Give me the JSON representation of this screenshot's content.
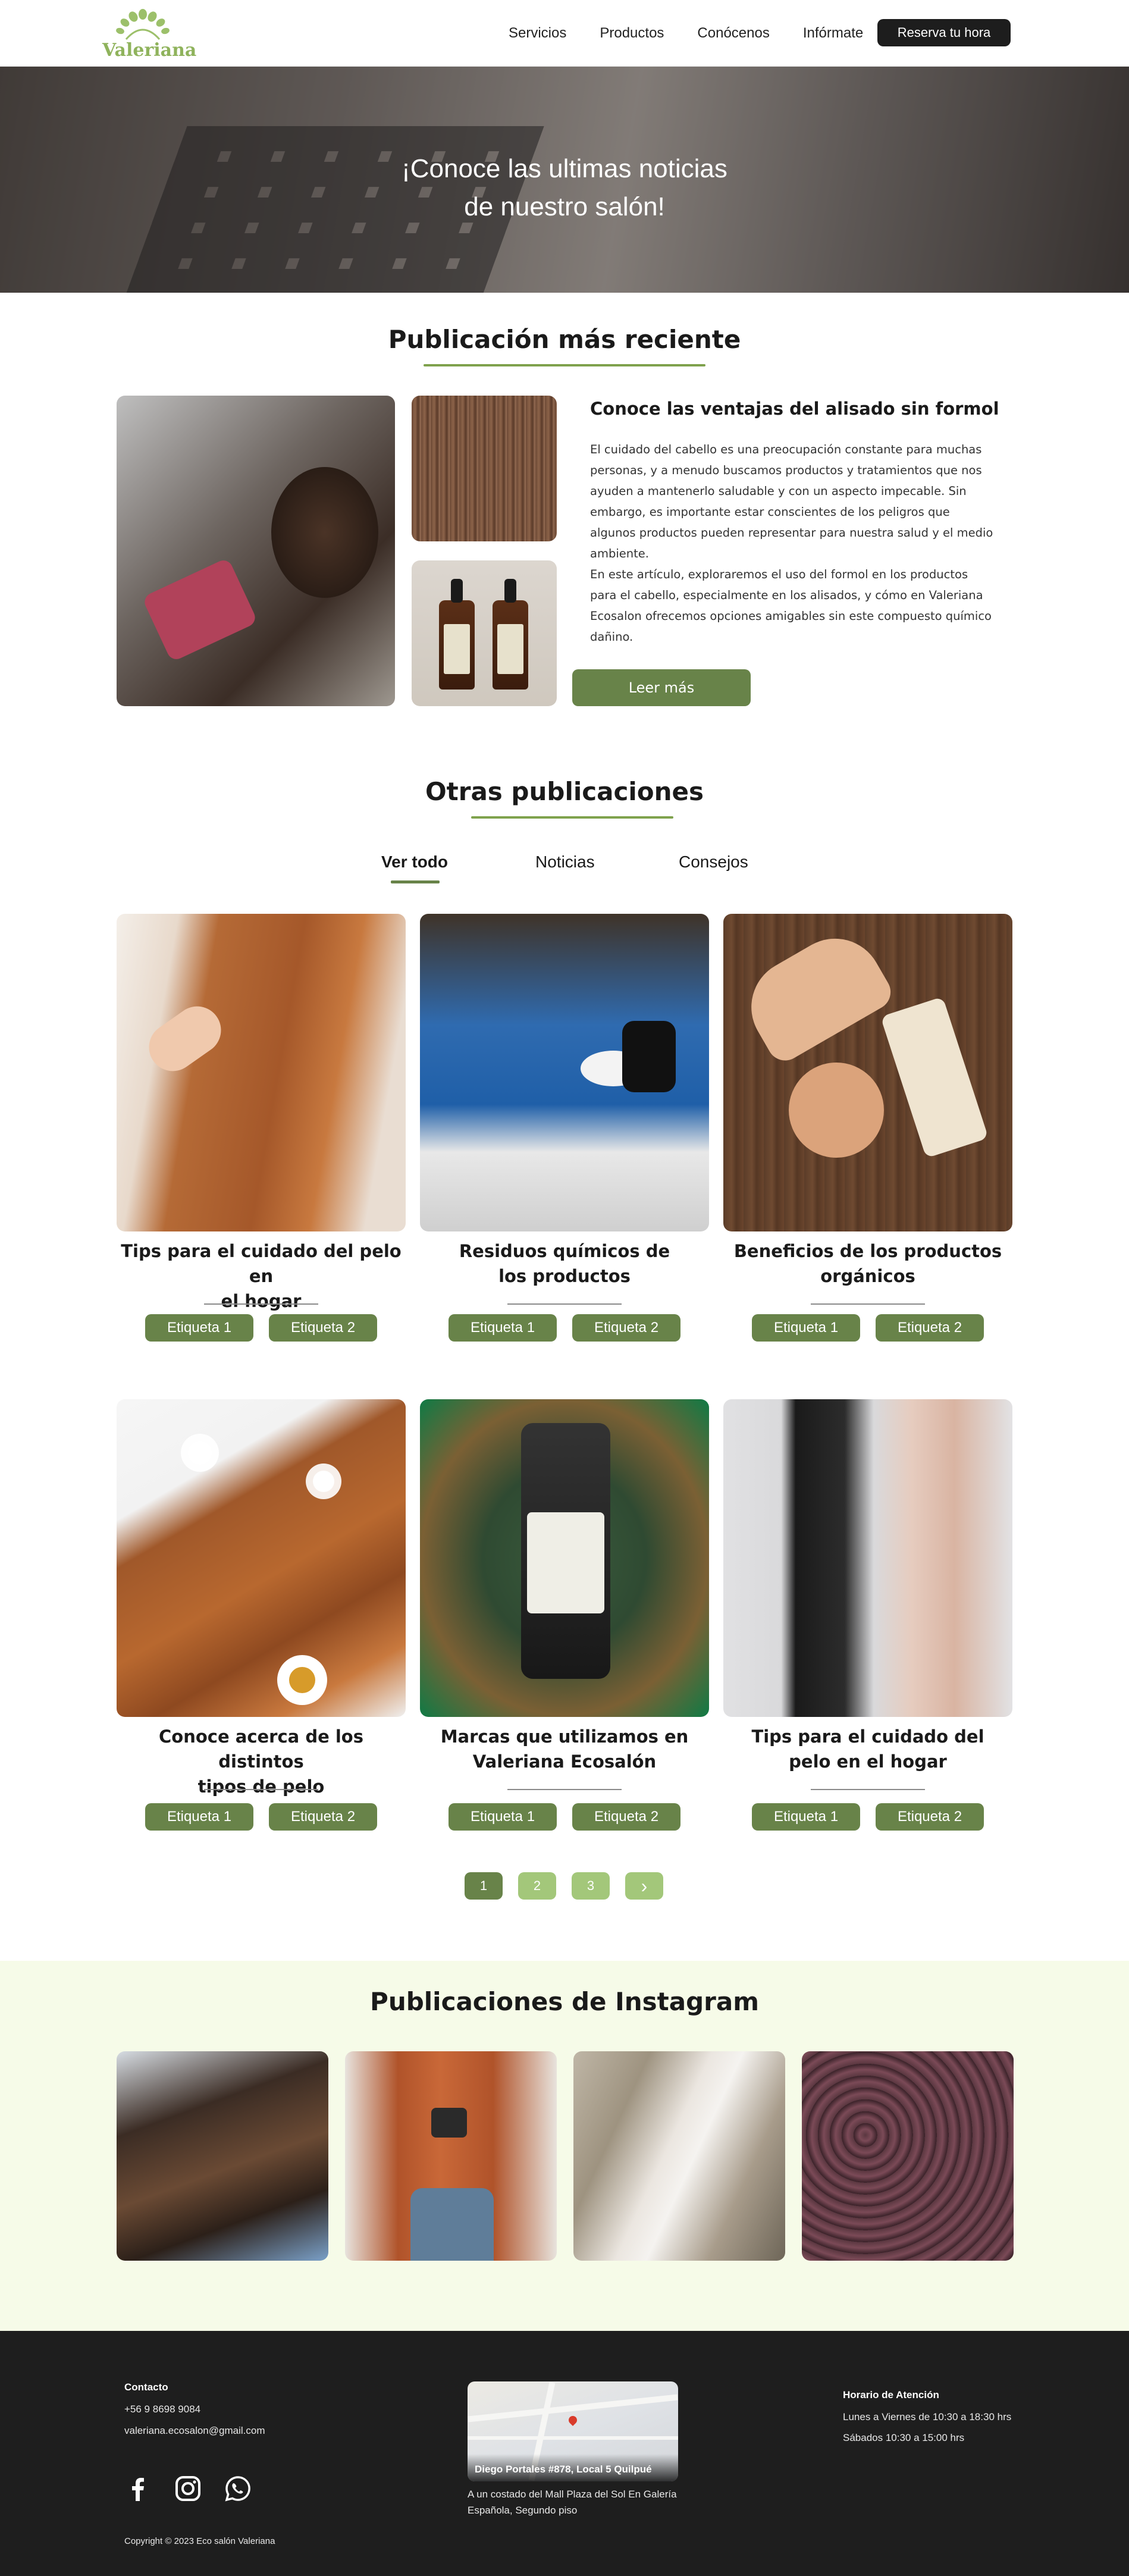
{
  "header": {
    "logo_text": "Valeriana",
    "nav": [
      "Servicios",
      "Productos",
      "Conócenos",
      "Infórmate"
    ],
    "cta": "Reserva tu hora"
  },
  "hero": {
    "title_line1": "¡Conoce las ultimas noticias",
    "title_line2": "de nuestro salón!"
  },
  "featured": {
    "section_title": "Publicación más reciente",
    "title": "Conoce las ventajas del alisado sin formol",
    "para1": "El cuidado del cabello es una preocupación constante para muchas personas, y a menudo buscamos productos y tratamientos que nos ayuden a mantenerlo saludable y con un aspecto impecable. Sin embargo, es importante estar conscientes de los peligros que algunos productos pueden representar para nuestra salud y el medio ambiente.",
    "para2": "En este artículo, exploraremos el uso del formol en los productos para el cabello, especialmente en los alisados, y cómo en Valeriana Ecosalon ofrecemos opciones amigables sin este compuesto químico dañino.",
    "button": "Leer más"
  },
  "others": {
    "section_title": "Otras publicaciones",
    "tabs": [
      "Ver todo",
      "Noticias",
      "Consejos"
    ],
    "active_tab": "Ver todo",
    "cards": [
      {
        "title1": "Tips para el cuidado del pelo en",
        "title2": "el hogar",
        "tag1": "Etiqueta 1",
        "tag2": "Etiqueta 2"
      },
      {
        "title1": "Residuos químicos de",
        "title2": "los productos",
        "tag1": "Etiqueta 1",
        "tag2": "Etiqueta 2"
      },
      {
        "title1": "Beneficios de los productos",
        "title2": "orgánicos",
        "tag1": "Etiqueta 1",
        "tag2": "Etiqueta 2"
      },
      {
        "title1": "Conoce acerca de los distintos",
        "title2": "tipos de pelo",
        "tag1": "Etiqueta 1",
        "tag2": "Etiqueta 2"
      },
      {
        "title1": "Marcas que utilizamos en",
        "title2": "Valeriana Ecosalón",
        "tag1": "Etiqueta 1",
        "tag2": "Etiqueta 2"
      },
      {
        "title1": "Tips para el cuidado del",
        "title2": "pelo en el hogar",
        "tag1": "Etiqueta 1",
        "tag2": "Etiqueta 2"
      }
    ],
    "pagination": [
      "1",
      "2",
      "3",
      "›"
    ],
    "current_page": "1"
  },
  "instagram": {
    "section_title": "Publicaciones de Instagram"
  },
  "footer": {
    "contact_title": "Contacto",
    "phone": "+56 9 8698 9084",
    "email": "valeriana.ecosalon@gmail.com",
    "map_caption": "Diego Portales #878, Local 5 Quilpué",
    "address_line1": "A un costado del Mall Plaza del Sol En Galería",
    "address_line2": "Española, Segundo piso",
    "hours_title": "Horario de Atención",
    "hours_weekdays": "Lunes a Viernes de 10:30 a 18:30 hrs",
    "hours_saturday": "Sábados 10:30 a 15:00 hrs",
    "copyright": "Copyright © 2023 Eco salón Valeriana",
    "social_icons": [
      "facebook-icon",
      "instagram-icon",
      "whatsapp-icon"
    ]
  },
  "colors": {
    "accent_green": "#688349",
    "light_green": "#a3c77a",
    "underline_green": "#7fa24d",
    "instagram_bg": "#f6fbe8",
    "footer_bg": "#1e1e1e",
    "cta_bg": "#1d1d1d"
  }
}
